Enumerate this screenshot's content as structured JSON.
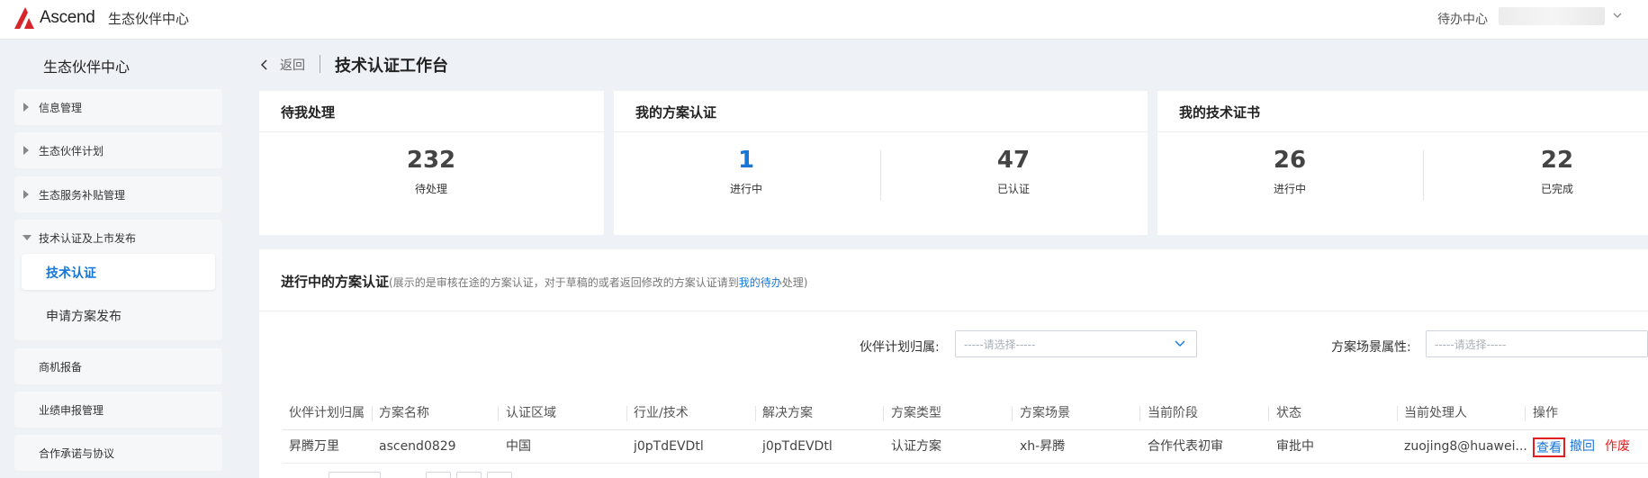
{
  "header": {
    "logo_text": "Ascend",
    "app_name": "生态伙伴中心",
    "todo_center": "待办中心"
  },
  "sidebar": {
    "title": "生态伙伴中心",
    "items": [
      {
        "label": "信息管理"
      },
      {
        "label": "生态伙伴计划"
      },
      {
        "label": "生态服务补贴管理"
      },
      {
        "label": "技术认证及上市发布",
        "children": [
          {
            "label": "技术认证",
            "active": true
          },
          {
            "label": "申请方案发布"
          }
        ]
      },
      {
        "label": "商机报备"
      },
      {
        "label": "业绩申报管理"
      },
      {
        "label": "合作承诺与协议"
      }
    ]
  },
  "breadcrumb": {
    "back": "返回",
    "title": "技术认证工作台"
  },
  "cards": [
    {
      "title": "待我处理",
      "stats": [
        {
          "value": "232",
          "label": "待处理"
        }
      ]
    },
    {
      "title": "我的方案认证",
      "stats": [
        {
          "value": "1",
          "label": "进行中"
        },
        {
          "value": "47",
          "label": "已认证"
        }
      ]
    },
    {
      "title": "我的技术证书",
      "stats": [
        {
          "value": "26",
          "label": "进行中"
        },
        {
          "value": "22",
          "label": "已完成"
        }
      ]
    }
  ],
  "panel": {
    "title": "进行中的方案认证",
    "note_prefix": "(展示的是审核在途的方案认证，对于草稿的或者返回修改的方案认证请到",
    "note_link": "我的待办",
    "note_suffix": "处理)",
    "filters": [
      {
        "label": "伙伴计划归属:",
        "placeholder": "-----请选择-----"
      },
      {
        "label": "方案场景属性:",
        "placeholder": "-----请选择-----"
      }
    ],
    "columns": [
      "伙伴计划归属",
      "方案名称",
      "认证区域",
      "行业/技术",
      "解决方案",
      "方案类型",
      "方案场景",
      "当前阶段",
      "状态",
      "当前处理人",
      "操作"
    ],
    "rows": [
      {
        "cells": [
          "昇腾万里",
          "ascend0829",
          "中国",
          "j0pTdEVDtl",
          "j0pTdEVDtl",
          "认证方案",
          "xh-昇腾",
          "合作代表初审",
          "审批中",
          "zuojing8@huawei...."
        ],
        "actions": {
          "view": "查看",
          "withdraw": "撤回",
          "void": "作废"
        }
      }
    ]
  },
  "colors": {
    "accent": "#1677d9",
    "danger": "#e02020",
    "logo_red": "#d6252b",
    "page_bg": "#eef1f6"
  }
}
